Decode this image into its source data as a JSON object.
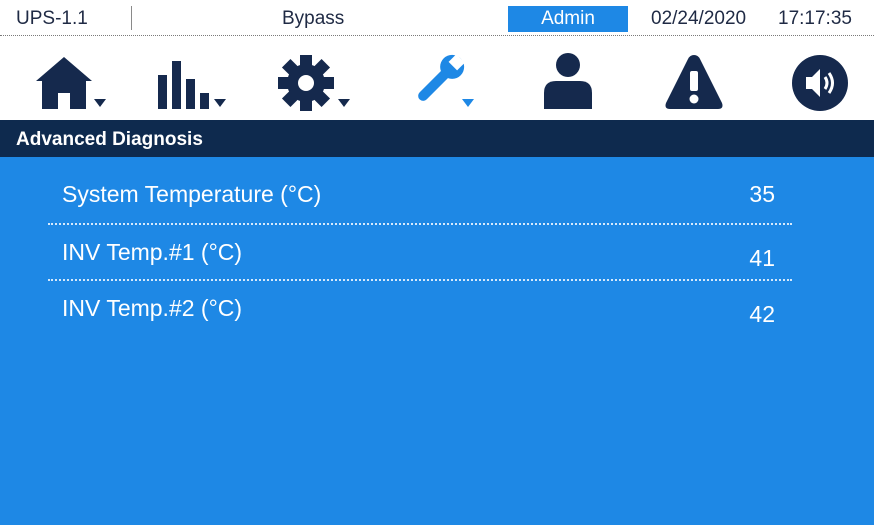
{
  "status_bar": {
    "device": "UPS-1.1",
    "mode": "Bypass",
    "user": "Admin",
    "date": "02/24/2020",
    "time": "17:17:35"
  },
  "toolbar": {
    "items": [
      {
        "icon": "home-icon",
        "has_dropdown": true,
        "active": false
      },
      {
        "icon": "bar-chart-icon",
        "has_dropdown": true,
        "active": false
      },
      {
        "icon": "gear-icon",
        "has_dropdown": true,
        "active": false
      },
      {
        "icon": "wrench-icon",
        "has_dropdown": true,
        "active": true
      },
      {
        "icon": "user-icon",
        "has_dropdown": false,
        "active": false
      },
      {
        "icon": "warning-icon",
        "has_dropdown": false,
        "active": false
      },
      {
        "icon": "speaker-icon",
        "has_dropdown": false,
        "active": false
      }
    ]
  },
  "section": {
    "title": "Advanced Diagnosis"
  },
  "rows": [
    {
      "label": "System Temperature (°C)",
      "value": "35"
    },
    {
      "label": "INV Temp.#1 (°C)",
      "value": "41"
    },
    {
      "label": "INV Temp.#2 (°C)",
      "value": "42"
    }
  ],
  "colors": {
    "accent_blue": "#1e88e5",
    "navy": "#0e2a4e",
    "icon_dark": "#15294d",
    "text_white": "#ffffff"
  }
}
